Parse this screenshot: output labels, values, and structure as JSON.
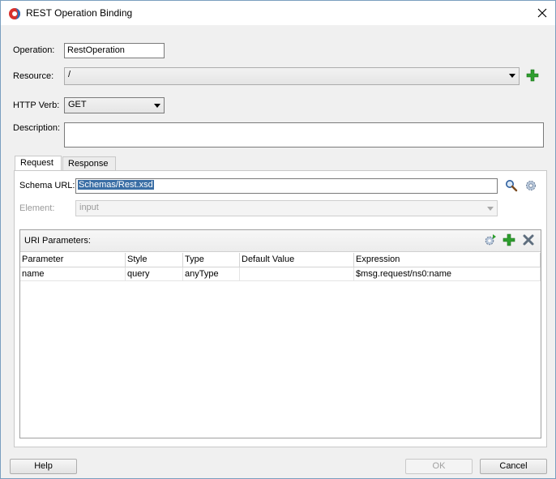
{
  "window": {
    "title": "REST Operation Binding"
  },
  "form": {
    "operation_label": "Operation:",
    "operation_value": "RestOperation",
    "resource_label": "Resource:",
    "resource_value": "/",
    "http_verb_label": "HTTP Verb:",
    "http_verb_value": "GET",
    "description_label": "Description:",
    "description_value": ""
  },
  "tabs": [
    {
      "label": "Request",
      "active": true
    },
    {
      "label": "Response",
      "active": false
    }
  ],
  "request": {
    "schema_url_label": "Schema URL:",
    "schema_url_value": "Schemas/Rest.xsd",
    "element_label": "Element:",
    "element_value": "input",
    "uri_parameters_label": "URI Parameters:",
    "columns": [
      "Parameter",
      "Style",
      "Type",
      "Default Value",
      "Expression"
    ],
    "rows": [
      {
        "parameter": "name",
        "style": "query",
        "type": "anyType",
        "default_value": "",
        "expression": "$msg.request/ns0:name"
      }
    ]
  },
  "buttons": {
    "help": "Help",
    "ok": "OK",
    "cancel": "Cancel"
  },
  "colors": {
    "add_green": "#2e9e2e",
    "selection_blue": "#3a6ea5",
    "window_border": "#7a9fbf"
  }
}
